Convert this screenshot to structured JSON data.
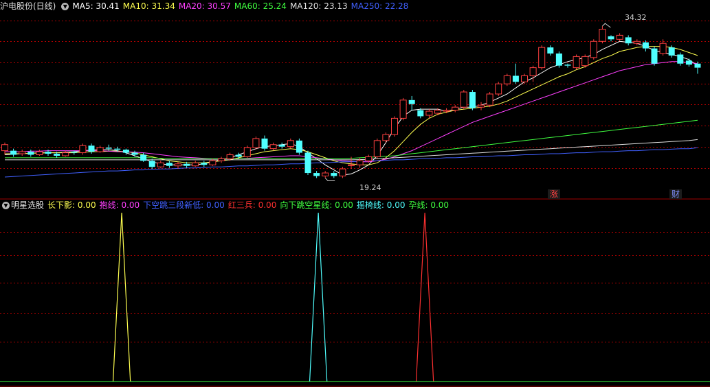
{
  "main_header": {
    "title": "沪电股份(日线)",
    "items": [
      {
        "label": "MA5:",
        "value": "30.41",
        "color": "#ffffff"
      },
      {
        "label": "MA10:",
        "value": "31.34",
        "color": "#ffff50"
      },
      {
        "label": "MA20:",
        "value": "30.57",
        "color": "#ff40ff"
      },
      {
        "label": "MA60:",
        "value": "25.24",
        "color": "#40ff40"
      },
      {
        "label": "MA120:",
        "value": "23.13",
        "color": "#e0e0e0"
      },
      {
        "label": "MA250:",
        "value": "22.28",
        "color": "#4060ff"
      }
    ]
  },
  "indicator_header": {
    "title": "明星选股",
    "items": [
      {
        "label": "长下影:",
        "value": "0.00",
        "color": "#ffff50"
      },
      {
        "label": "抱线:",
        "value": "0.00",
        "color": "#ff40ff"
      },
      {
        "label": "下空跳三段新低:",
        "value": "0.00",
        "color": "#4060ff"
      },
      {
        "label": "红三兵:",
        "value": "0.00",
        "color": "#ff3030"
      },
      {
        "label": "向下跳空星线:",
        "value": "0.00",
        "color": "#40ff40"
      },
      {
        "label": "摇椅线:",
        "value": "0.00",
        "color": "#50ffff"
      },
      {
        "label": "孕线:",
        "value": "0.00",
        "color": "#40ff40"
      }
    ]
  },
  "tags": {
    "zhang": "涨",
    "cai": "财"
  },
  "peaks": {
    "high_label": "34.32",
    "low_label": "19.24"
  },
  "chart_data": [
    {
      "type": "candlestick",
      "y_range": [
        17.5,
        35.8
      ],
      "grid": true,
      "candles": [
        [
          22.0,
          22.6,
          21.6,
          22.8
        ],
        [
          22.0,
          21.6,
          21.4,
          22.2
        ],
        [
          21.7,
          21.9,
          21.5,
          22.1
        ],
        [
          21.9,
          21.6,
          21.4,
          22.1
        ],
        [
          21.6,
          21.9,
          21.5,
          22.1
        ],
        [
          21.9,
          21.7,
          21.5,
          22.1
        ],
        [
          21.7,
          21.5,
          21.3,
          21.9
        ],
        [
          21.5,
          21.8,
          21.4,
          22.0
        ],
        [
          21.9,
          21.8,
          21.6,
          22.0
        ],
        [
          21.8,
          22.5,
          21.6,
          22.7
        ],
        [
          22.5,
          21.9,
          21.7,
          22.7
        ],
        [
          21.9,
          22.3,
          21.8,
          22.5
        ],
        [
          22.3,
          22.2,
          22.0,
          22.6
        ],
        [
          22.2,
          22.1,
          21.9,
          22.4
        ],
        [
          22.1,
          21.8,
          21.6,
          22.2
        ],
        [
          21.8,
          21.6,
          21.4,
          22.0
        ],
        [
          21.6,
          21.0,
          20.9,
          21.8
        ],
        [
          21.0,
          20.4,
          20.2,
          21.2
        ],
        [
          20.4,
          20.8,
          20.3,
          21.0
        ],
        [
          20.8,
          20.5,
          20.3,
          21.0
        ],
        [
          20.5,
          20.7,
          20.2,
          20.9
        ],
        [
          20.7,
          20.5,
          20.3,
          20.9
        ],
        [
          20.5,
          20.8,
          20.4,
          21.0
        ],
        [
          20.8,
          20.6,
          20.4,
          21.0
        ],
        [
          20.6,
          21.0,
          20.5,
          21.2
        ],
        [
          21.0,
          21.2,
          20.8,
          21.4
        ],
        [
          21.2,
          21.6,
          21.0,
          21.8
        ],
        [
          21.6,
          21.4,
          21.2,
          21.8
        ],
        [
          21.4,
          22.3,
          21.3,
          22.5
        ],
        [
          22.3,
          23.2,
          22.1,
          23.4
        ],
        [
          23.2,
          22.2,
          22.0,
          23.5
        ],
        [
          22.2,
          22.6,
          22.0,
          22.8
        ],
        [
          22.6,
          22.4,
          22.2,
          22.8
        ],
        [
          22.4,
          23.0,
          22.2,
          23.2
        ],
        [
          23.0,
          21.8,
          21.6,
          23.2
        ],
        [
          21.8,
          19.8,
          19.6,
          22.0
        ],
        [
          19.8,
          19.5,
          19.3,
          20.0
        ],
        [
          19.5,
          19.8,
          19.3,
          20.0
        ],
        [
          19.8,
          19.5,
          19.3,
          20.0
        ],
        [
          19.5,
          20.2,
          19.3,
          20.4
        ],
        [
          20.6,
          20.6,
          20.2,
          21.4
        ],
        [
          20.6,
          21.0,
          20.3,
          21.3
        ],
        [
          21.0,
          21.4,
          20.8,
          21.6
        ],
        [
          21.4,
          23.0,
          21.2,
          23.2
        ],
        [
          23.0,
          23.6,
          22.8,
          23.8
        ],
        [
          23.6,
          25.2,
          23.4,
          25.4
        ],
        [
          25.2,
          27.0,
          25.0,
          27.2
        ],
        [
          27.0,
          26.6,
          26.0,
          27.4
        ],
        [
          26.0,
          25.4,
          25.2,
          26.2
        ],
        [
          25.5,
          25.9,
          25.2,
          26.1
        ],
        [
          25.7,
          26.0,
          25.5,
          26.2
        ],
        [
          25.9,
          26.0,
          25.7,
          26.2
        ],
        [
          26.0,
          26.3,
          25.8,
          26.5
        ],
        [
          26.3,
          27.8,
          26.1,
          28.0
        ],
        [
          27.8,
          26.2,
          26.0,
          28.0
        ],
        [
          26.3,
          26.5,
          26.0,
          26.8
        ],
        [
          26.5,
          27.6,
          26.3,
          27.8
        ],
        [
          27.6,
          28.6,
          27.4,
          28.8
        ],
        [
          28.6,
          29.4,
          28.4,
          29.6
        ],
        [
          29.4,
          28.8,
          28.6,
          30.6
        ],
        [
          28.8,
          29.4,
          28.6,
          29.6
        ],
        [
          29.4,
          30.2,
          28.8,
          30.4
        ],
        [
          30.2,
          32.2,
          30.0,
          32.4
        ],
        [
          32.2,
          31.6,
          31.4,
          32.4
        ],
        [
          31.6,
          30.4,
          30.2,
          31.8
        ],
        [
          30.5,
          30.4,
          30.2,
          30.6
        ],
        [
          30.2,
          31.3,
          30.0,
          31.5
        ],
        [
          30.4,
          31.3,
          30.2,
          31.5
        ],
        [
          31.2,
          32.8,
          31.0,
          33.0
        ],
        [
          32.8,
          34.0,
          32.6,
          34.3
        ],
        [
          33.3,
          33.0,
          32.8,
          33.4
        ],
        [
          33.0,
          33.4,
          32.8,
          33.6
        ],
        [
          33.2,
          32.6,
          32.4,
          33.4
        ],
        [
          32.6,
          32.8,
          32.4,
          33.0
        ],
        [
          32.7,
          32.1,
          31.8,
          32.9
        ],
        [
          32.1,
          30.6,
          30.4,
          32.3
        ],
        [
          31.6,
          32.6,
          31.4,
          33.0
        ],
        [
          32.2,
          31.4,
          31.2,
          32.4
        ],
        [
          31.5,
          30.6,
          30.4,
          31.7
        ],
        [
          30.9,
          30.5,
          30.3,
          31.1
        ],
        [
          30.6,
          30.2,
          29.6,
          30.8
        ]
      ],
      "ma_series": [
        {
          "name": "MA5",
          "color": "#ffffff",
          "values": [
            21.6,
            21.65,
            21.7,
            21.75,
            21.8,
            21.8,
            21.8,
            21.85,
            21.9,
            22.0,
            22.05,
            22.1,
            22.1,
            22.0,
            21.8,
            21.5,
            21.2,
            20.9,
            20.7,
            20.6,
            20.6,
            20.6,
            20.6,
            20.7,
            20.9,
            21.1,
            21.3,
            21.6,
            21.9,
            22.2,
            22.4,
            22.5,
            22.6,
            22.7,
            22.4,
            21.8,
            21.2,
            20.6,
            20.1,
            19.6,
            19.7,
            20.1,
            20.6,
            21.5,
            22.8,
            24.2,
            25.4,
            26.0,
            26.1,
            26.1,
            26.1,
            25.9,
            26.1,
            26.3,
            26.3,
            26.5,
            26.8,
            27.2,
            27.6,
            28.2,
            28.8,
            29.2,
            29.7,
            30.2,
            30.5,
            30.8,
            31.0,
            31.2,
            31.5,
            32.0,
            32.4,
            32.8,
            32.7,
            32.6,
            32.3,
            31.9,
            31.7,
            31.5,
            31.3,
            31.0,
            30.4
          ]
        },
        {
          "name": "MA10",
          "color": "#ffff50",
          "values": [
            21.7,
            21.7,
            21.7,
            21.75,
            21.75,
            21.8,
            21.8,
            21.8,
            21.8,
            21.85,
            21.9,
            21.9,
            21.95,
            21.95,
            21.9,
            21.8,
            21.6,
            21.4,
            21.2,
            21.0,
            20.9,
            20.8,
            20.8,
            20.8,
            20.9,
            21.0,
            21.1,
            21.3,
            21.5,
            21.7,
            21.9,
            22.0,
            22.1,
            22.2,
            22.1,
            21.9,
            21.6,
            21.3,
            21.0,
            20.8,
            20.7,
            20.6,
            20.6,
            20.8,
            21.3,
            22.0,
            22.9,
            23.8,
            24.6,
            25.2,
            25.6,
            25.8,
            26.0,
            26.1,
            26.2,
            26.3,
            26.4,
            26.6,
            26.9,
            27.3,
            27.7,
            28.1,
            28.5,
            28.9,
            29.3,
            29.6,
            30.0,
            30.3,
            30.7,
            31.1,
            31.4,
            31.8,
            32.0,
            32.2,
            32.3,
            32.3,
            32.3,
            32.2,
            32.0,
            31.7,
            31.4
          ]
        },
        {
          "name": "MA20",
          "color": "#ff40ff",
          "values": [
            21.9,
            21.9,
            21.9,
            21.95,
            21.95,
            22.0,
            22.0,
            22.0,
            22.0,
            22.0,
            22.0,
            22.0,
            21.95,
            21.9,
            21.9,
            21.85,
            21.8,
            21.7,
            21.6,
            21.5,
            21.4,
            21.35,
            21.3,
            21.25,
            21.2,
            21.2,
            21.2,
            21.2,
            21.25,
            21.3,
            21.35,
            21.4,
            21.45,
            21.5,
            21.5,
            21.4,
            21.3,
            21.2,
            21.1,
            21.0,
            20.95,
            20.9,
            20.9,
            21.0,
            21.15,
            21.4,
            21.7,
            22.0,
            22.4,
            22.8,
            23.2,
            23.6,
            24.0,
            24.4,
            24.8,
            25.1,
            25.4,
            25.7,
            26.0,
            26.3,
            26.6,
            26.9,
            27.2,
            27.5,
            27.8,
            28.1,
            28.4,
            28.7,
            29.0,
            29.3,
            29.6,
            29.9,
            30.1,
            30.3,
            30.5,
            30.6,
            30.7,
            30.8,
            30.8,
            30.7,
            30.6
          ]
        },
        {
          "name": "MA60",
          "color": "#40ff40",
          "values": [
            21.3,
            21.3,
            21.3,
            21.3,
            21.3,
            21.3,
            21.3,
            21.3,
            21.3,
            21.3,
            21.3,
            21.3,
            21.3,
            21.3,
            21.3,
            21.3,
            21.3,
            21.3,
            21.25,
            21.2,
            21.2,
            21.2,
            21.2,
            21.2,
            21.2,
            21.2,
            21.2,
            21.2,
            21.2,
            21.2,
            21.2,
            21.2,
            21.2,
            21.2,
            21.2,
            21.2,
            21.2,
            21.2,
            21.2,
            21.2,
            21.25,
            21.3,
            21.35,
            21.4,
            21.45,
            21.5,
            21.6,
            21.7,
            21.8,
            21.9,
            22.0,
            22.1,
            22.2,
            22.3,
            22.4,
            22.5,
            22.6,
            22.7,
            22.8,
            22.9,
            23.0,
            23.1,
            23.2,
            23.3,
            23.4,
            23.5,
            23.6,
            23.7,
            23.8,
            23.9,
            24.0,
            24.1,
            24.2,
            24.3,
            24.4,
            24.5,
            24.6,
            24.7,
            24.8,
            24.9,
            25.0
          ]
        },
        {
          "name": "MA120",
          "color": "#e0e0e0",
          "values": [
            21.1,
            21.1,
            21.1,
            21.1,
            21.1,
            21.1,
            21.1,
            21.1,
            21.1,
            21.1,
            21.1,
            21.1,
            21.1,
            21.1,
            21.1,
            21.1,
            21.1,
            21.1,
            21.1,
            21.1,
            21.1,
            21.1,
            21.1,
            21.1,
            21.1,
            21.1,
            21.1,
            21.1,
            21.1,
            21.1,
            21.1,
            21.1,
            21.1,
            21.1,
            21.1,
            21.1,
            21.1,
            21.1,
            21.1,
            21.1,
            21.1,
            21.12,
            21.15,
            21.2,
            21.25,
            21.3,
            21.35,
            21.4,
            21.45,
            21.5,
            21.55,
            21.6,
            21.65,
            21.7,
            21.75,
            21.8,
            21.85,
            21.9,
            21.95,
            22.0,
            22.05,
            22.1,
            22.15,
            22.2,
            22.25,
            22.3,
            22.35,
            22.4,
            22.45,
            22.5,
            22.55,
            22.6,
            22.65,
            22.7,
            22.75,
            22.8,
            22.85,
            22.9,
            22.95,
            23.0,
            23.1
          ]
        },
        {
          "name": "MA250",
          "color": "#4060ff",
          "values": [
            19.4,
            19.45,
            19.5,
            19.55,
            19.6,
            19.65,
            19.7,
            19.75,
            19.8,
            19.85,
            19.9,
            19.95,
            20.0,
            20.0,
            20.05,
            20.1,
            20.1,
            20.15,
            20.2,
            20.2,
            20.25,
            20.3,
            20.3,
            20.35,
            20.4,
            20.4,
            20.45,
            20.5,
            20.5,
            20.55,
            20.6,
            20.6,
            20.65,
            20.7,
            20.7,
            20.75,
            20.8,
            20.8,
            20.85,
            20.9,
            20.9,
            20.95,
            21.0,
            21.0,
            21.05,
            21.1,
            21.1,
            21.15,
            21.2,
            21.2,
            21.25,
            21.3,
            21.3,
            21.35,
            21.4,
            21.4,
            21.45,
            21.5,
            21.5,
            21.55,
            21.6,
            21.6,
            21.65,
            21.7,
            21.7,
            21.75,
            21.8,
            21.8,
            21.85,
            21.9,
            21.9,
            21.95,
            22.0,
            22.0,
            22.05,
            22.1,
            22.1,
            22.15,
            22.2,
            22.2,
            22.3
          ]
        }
      ],
      "high_index": 69,
      "low_index": 37
    },
    {
      "type": "line",
      "y_range": [
        0,
        1
      ],
      "grid": true,
      "spikes": [
        {
          "color": "#ffff50",
          "start": 12.5,
          "peak": 13.5,
          "end": 14.5
        },
        {
          "color": "#50ffff",
          "start": 35.2,
          "peak": 36.2,
          "end": 37.2
        },
        {
          "color": "#ff3030",
          "start": 47.5,
          "peak": 48.5,
          "end": 49.5
        }
      ],
      "baseline_color": "#40ff40"
    }
  ]
}
